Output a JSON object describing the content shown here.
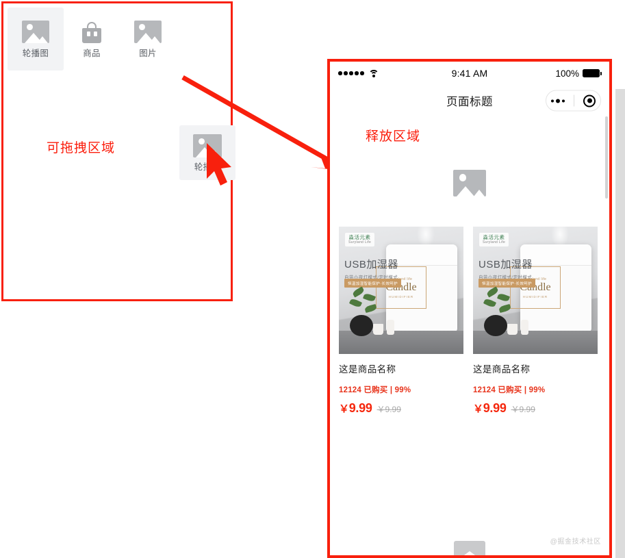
{
  "palette": {
    "drag_area_label": "可拖拽区域",
    "items": [
      {
        "label": "轮播图",
        "icon": "image-placeholder-icon",
        "selected": true
      },
      {
        "label": "商品",
        "icon": "shopping-bag-icon",
        "selected": false
      },
      {
        "label": "图片",
        "icon": "image-placeholder-icon",
        "selected": false
      }
    ],
    "dragging_item": {
      "label": "轮播图",
      "icon": "image-placeholder-icon"
    }
  },
  "annotation": {
    "arrow_color": "#f8200d",
    "cursor_color": "#f8200d"
  },
  "preview": {
    "release_area_label": "释放区域",
    "status_bar": {
      "signal_dots": 5,
      "wifi": "wifi-icon",
      "time": "9:41 AM",
      "battery_percent": "100%"
    },
    "nav": {
      "title": "页面标题",
      "capsule_menu_icon": "more-dots-icon",
      "capsule_target_icon": "target-circle-icon"
    },
    "banner_slot": {
      "icon": "image-placeholder-icon"
    },
    "goods": [
      {
        "name": "这是商品名称",
        "meta": "12124 已购买 | 99%",
        "price_symbol": "￥",
        "price": "9.99",
        "old_price": "￥9.99",
        "image": {
          "brand_cn": "淼活元素",
          "brand_en": "Suryland Life",
          "title_cn": "USB加湿器",
          "subtitle_cn": "自带小夜灯模式/定时模式",
          "tag": "恒温加湿智能保护·长效呵护",
          "medallion_top": "Suryland life",
          "medallion_main": "Candle",
          "medallion_sub": "HUMIDIFIER"
        }
      },
      {
        "name": "这是商品名称",
        "meta": "12124 已购买 | 99%",
        "price_symbol": "￥",
        "price": "9.99",
        "old_price": "￥9.99",
        "image": {
          "brand_cn": "淼活元素",
          "brand_en": "Suryland Life",
          "title_cn": "USB加湿器",
          "subtitle_cn": "自带小夜灯模式/定时模式",
          "tag": "恒温加湿智能保护·长效呵护",
          "medallion_top": "Suryland life",
          "medallion_main": "Candle",
          "medallion_sub": "HUMIDIFIER"
        }
      }
    ],
    "watermark": "@掘金技术社区"
  },
  "colors": {
    "annotation_red": "#f8200d",
    "price_red": "#f5270d",
    "placeholder_gray": "#b6b8bb",
    "panel_gray": "#f2f3f5"
  }
}
